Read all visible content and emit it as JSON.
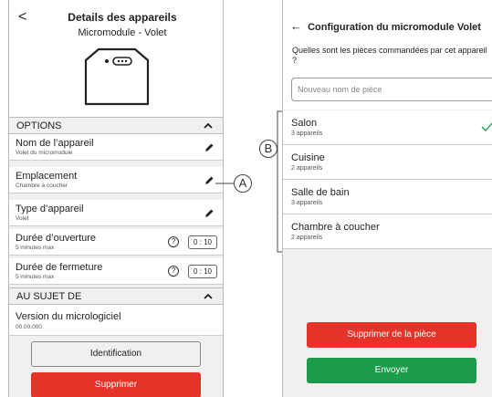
{
  "left": {
    "back": "<",
    "title": "Details des appareils",
    "subtitle": "Micromodule - Volet",
    "options_header": "OPTIONS",
    "rows": [
      {
        "label": "Nom de l’appareil",
        "sub": "Volet du micromodule"
      },
      {
        "label": "Emplacement",
        "sub": "Chambre à coucher"
      },
      {
        "label": "Type d’appareil",
        "sub": "Volet"
      },
      {
        "label": "Durée d’ouverture",
        "sub": "5 minutes max",
        "value": "0 : 10"
      },
      {
        "label": "Durée de fermeture",
        "sub": "5 minutes max",
        "value": "0 : 10"
      }
    ],
    "about_header": "AU SUJET DE",
    "firmware": {
      "label": "Version du micrologiciel",
      "value": "00.00.000"
    },
    "identification_button": "Identification",
    "delete_button": "Supprimer"
  },
  "callouts": {
    "a": "A",
    "b": "B"
  },
  "right": {
    "back": "←",
    "title": "Configuration du micromodule Volet",
    "question": "Quelles sont les pièces commandées par cet appareil ?",
    "input_placeholder": "Nouveau nom de pièce",
    "rooms": [
      {
        "name": "Salon",
        "count": "3 appareils",
        "selected": true
      },
      {
        "name": "Cuisine",
        "count": "2 appareils",
        "selected": false
      },
      {
        "name": "Salle de bain",
        "count": "3 appareils",
        "selected": false
      },
      {
        "name": "Chambre à coucher",
        "count": "2 appareils",
        "selected": false
      }
    ],
    "remove_button": "Supprimer de la pièce",
    "send_button": "Envoyer"
  },
  "colors": {
    "red": "#e63329",
    "green": "#1a9c4a",
    "check": "#1a9c4a"
  }
}
